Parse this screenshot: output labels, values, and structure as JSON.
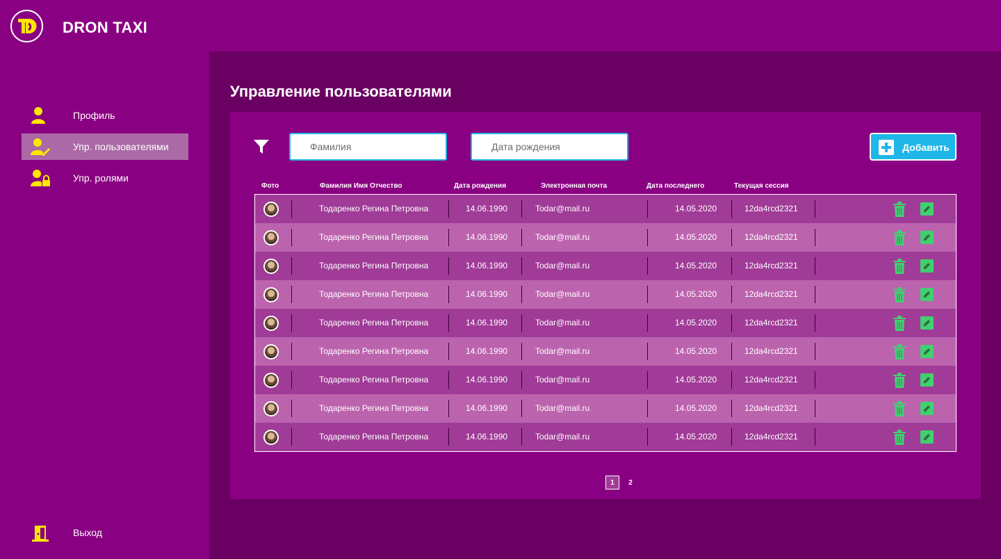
{
  "app": {
    "brand": "DRON TAXI"
  },
  "sidebar": {
    "items": [
      {
        "label": "Профиль",
        "icon": "user-icon"
      },
      {
        "label": "Упр. пользователями",
        "icon": "user-edit-icon",
        "active": true
      },
      {
        "label": "Упр. ролями",
        "icon": "users-lock-icon"
      }
    ],
    "logout": {
      "label": "Выход",
      "icon": "door-exit-icon"
    }
  },
  "main": {
    "title": "Управление пользователями",
    "filters": {
      "lastname_placeholder": "Фамилия",
      "birthdate_placeholder": "Дата рождения"
    },
    "add_button": "Добавить",
    "columns": [
      "Фото",
      "Фамилия Имя Отчество",
      "Дата рождения",
      "Электронная почта",
      "Дата последнего",
      "Текущая сессия"
    ],
    "rows": [
      {
        "name": "Тодаренко Регина Петровна",
        "birth": "14.06.1990",
        "email": "Todar@mail.ru",
        "last": "14.05.2020",
        "session": "12da4rcd2321"
      },
      {
        "name": "Тодаренко Регина Петровна",
        "birth": "14.06.1990",
        "email": "Todar@mail.ru",
        "last": "14.05.2020",
        "session": "12da4rcd2321"
      },
      {
        "name": "Тодаренко Регина Петровна",
        "birth": "14.06.1990",
        "email": "Todar@mail.ru",
        "last": "14.05.2020",
        "session": "12da4rcd2321"
      },
      {
        "name": "Тодаренко Регина Петровна",
        "birth": "14.06.1990",
        "email": "Todar@mail.ru",
        "last": "14.05.2020",
        "session": "12da4rcd2321"
      },
      {
        "name": "Тодаренко Регина Петровна",
        "birth": "14.06.1990",
        "email": "Todar@mail.ru",
        "last": "14.05.2020",
        "session": "12da4rcd2321"
      },
      {
        "name": "Тодаренко Регина Петровна",
        "birth": "14.06.1990",
        "email": "Todar@mail.ru",
        "last": "14.05.2020",
        "session": "12da4rcd2321"
      },
      {
        "name": "Тодаренко Регина Петровна",
        "birth": "14.06.1990",
        "email": "Todar@mail.ru",
        "last": "14.05.2020",
        "session": "12da4rcd2321"
      },
      {
        "name": "Тодаренко Регина Петровна",
        "birth": "14.06.1990",
        "email": "Todar@mail.ru",
        "last": "14.05.2020",
        "session": "12da4rcd2321"
      },
      {
        "name": "Тодаренко Регина Петровна",
        "birth": "14.06.1990",
        "email": "Todar@mail.ru",
        "last": "14.05.2020",
        "session": "12da4rcd2321"
      }
    ],
    "pagination": [
      "1",
      "2"
    ]
  },
  "colors": {
    "background": "#8a0082",
    "main_bg": "#6a0062",
    "accent_yellow": "#ffe600",
    "accent_blue": "#1fb6e8",
    "action_green": "#3fd16e",
    "row_odd": "#a03b97",
    "row_even": "#bc63ae",
    "active_nav": "#ab6aa7"
  }
}
